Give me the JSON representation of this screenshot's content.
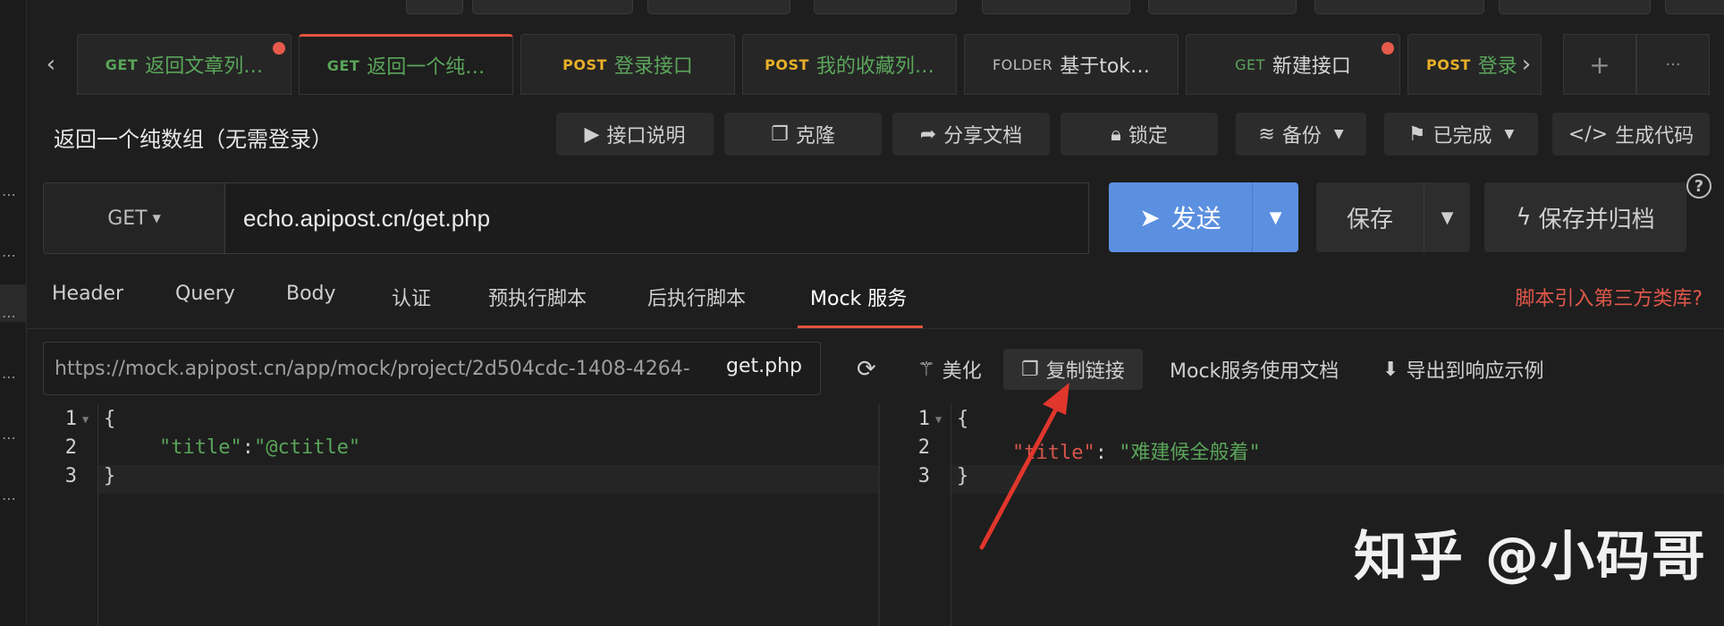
{
  "tabs": [
    {
      "method": "GET",
      "name": "返回文章列…",
      "unsaved": true,
      "active": false
    },
    {
      "method": "GET",
      "name": "返回一个纯…",
      "unsaved": false,
      "active": true
    },
    {
      "method": "POST",
      "name": "登录接口",
      "unsaved": false,
      "active": false
    },
    {
      "method": "POST",
      "name": "我的收藏列…",
      "unsaved": false,
      "active": false
    },
    {
      "method": "FOLDER",
      "name": "基于tok…",
      "unsaved": false,
      "active": false
    },
    {
      "method": "GET",
      "name": "新建接口",
      "unsaved": true,
      "active": false
    },
    {
      "method": "POST",
      "name": "登录",
      "unsaved": false,
      "active": false
    }
  ],
  "tab_actions": {
    "add": "+",
    "more": "···"
  },
  "page_title": "返回一个纯数组（无需登录）",
  "toolbar": {
    "doc": "接口说明",
    "clone": "克隆",
    "share": "分享文档",
    "lock": "锁定",
    "backup": "备份",
    "status": "已完成",
    "codegen": "生成代码"
  },
  "request": {
    "method": "GET",
    "url": "echo.apipost.cn/get.php",
    "send": "发送",
    "save": "保存",
    "save_archive": "保存并归档",
    "help": "?"
  },
  "sub_tabs": [
    "Header",
    "Query",
    "Body",
    "认证",
    "预执行脚本",
    "后执行脚本",
    "Mock 服务"
  ],
  "active_sub_tab": "Mock 服务",
  "script_link": "脚本引入第三方类库?",
  "mock": {
    "url": "https://mock.apipost.cn/app/mock/project/2d504cdc-1408-4264-",
    "url_suffix": "get.php",
    "beautify": "美化",
    "copy_link": "复制链接",
    "docs": "Mock服务使用文档",
    "export": "导出到响应示例"
  },
  "editor_left": {
    "lines": [
      "1",
      "2",
      "3"
    ],
    "open": "{",
    "key": "\"title\"",
    "colon": ":",
    "value": "\"@ctitle\"",
    "close": "}"
  },
  "editor_right": {
    "lines": [
      "1",
      "2",
      "3"
    ],
    "open": "{",
    "key": "\"title\"",
    "colon": ": ",
    "value": "\"难建候全般着\"",
    "close": "}"
  },
  "watermark": "知乎 @小码哥",
  "colors": {
    "accent": "#e0543f",
    "send": "#5b8fe0",
    "get": "#5aa55a",
    "post": "#e8b028",
    "annotation": "#e0362c"
  }
}
